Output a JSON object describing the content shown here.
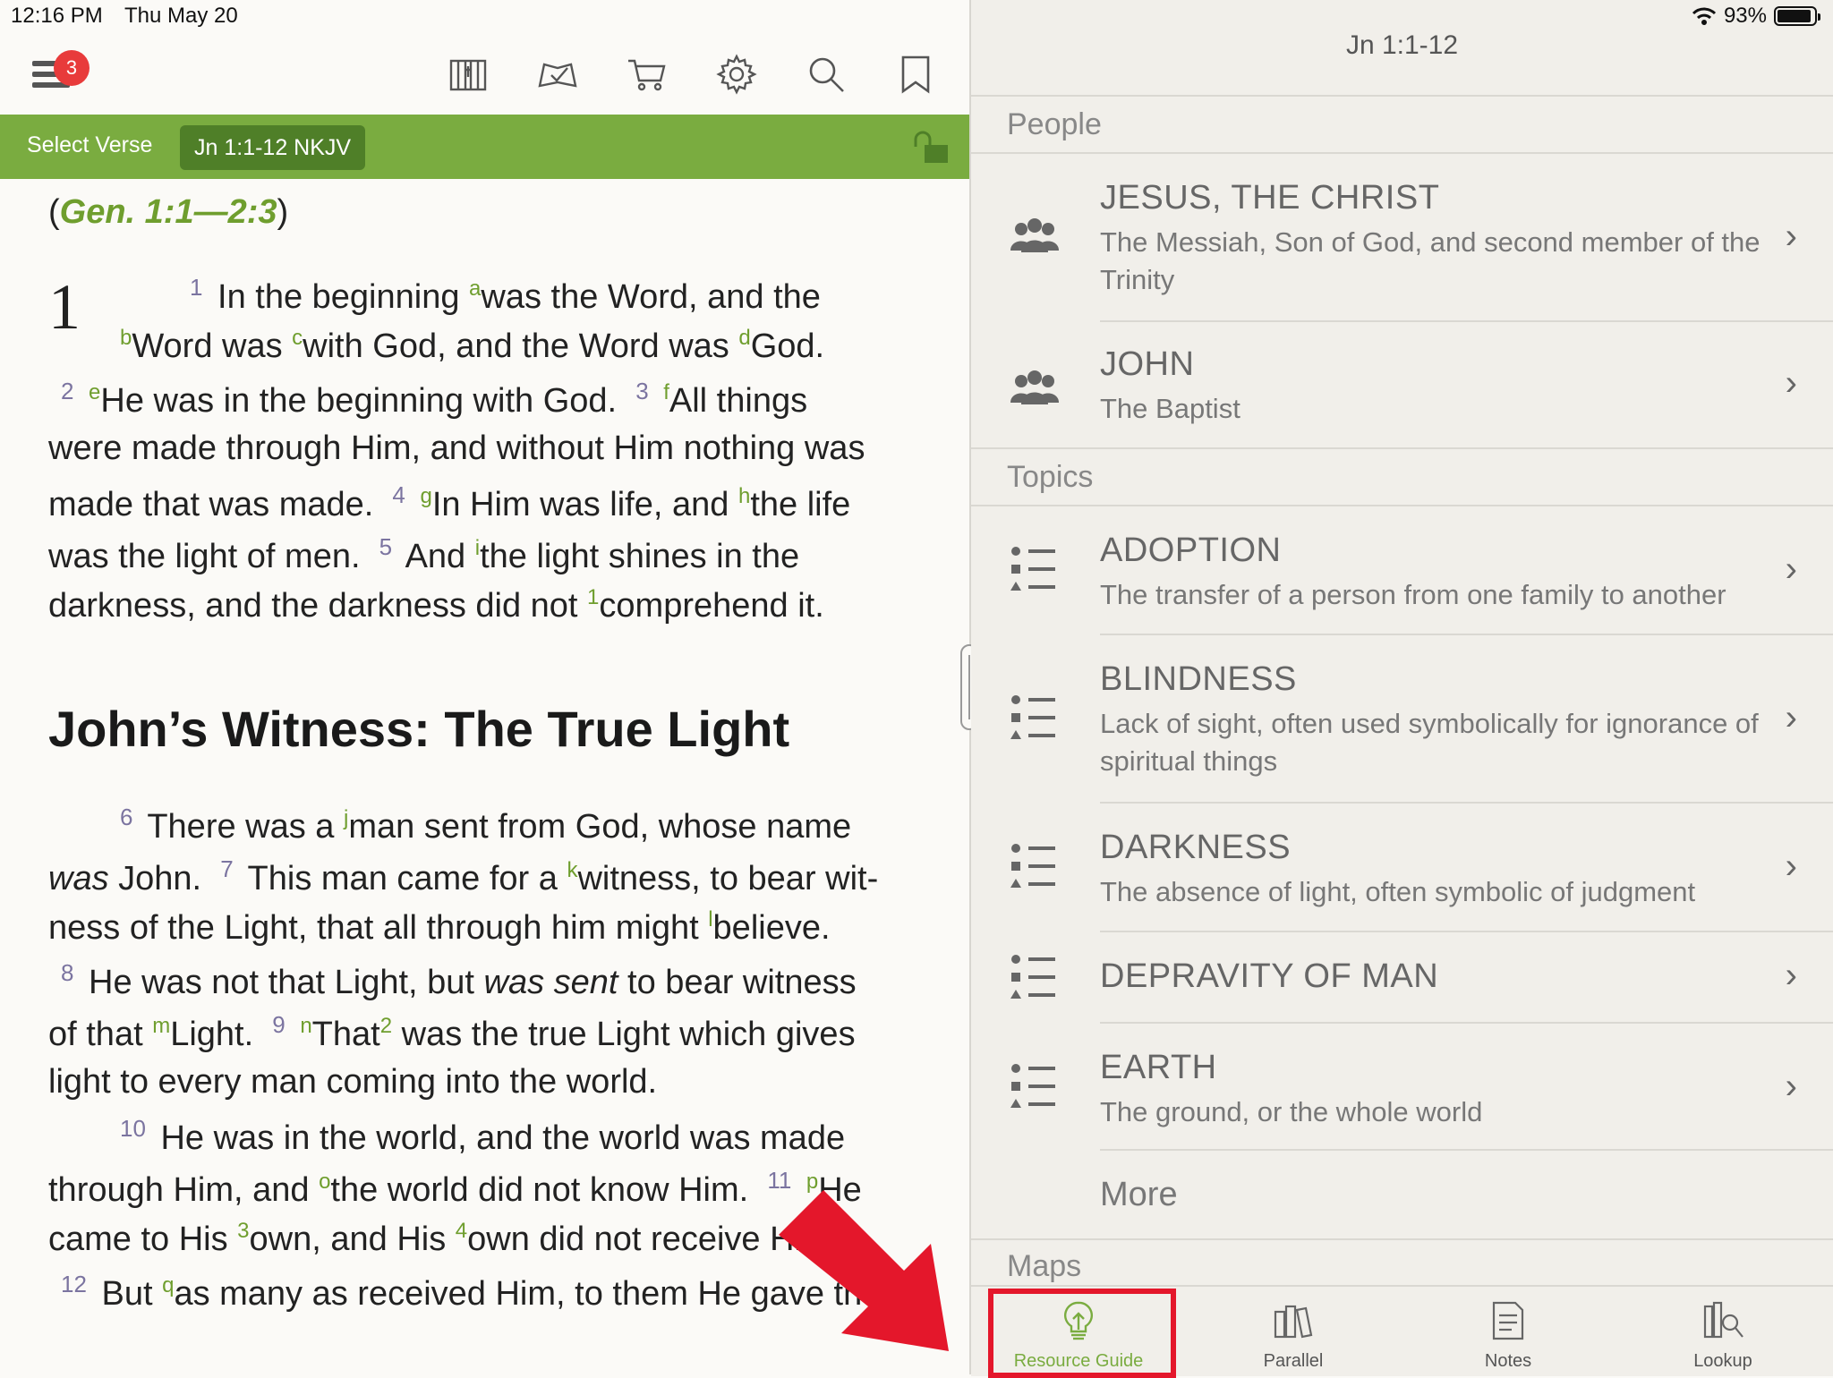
{
  "status": {
    "time": "12:16 PM",
    "date": "Thu May 20",
    "battery": "93%",
    "battery_level": 0.93
  },
  "toolbar": {
    "menu_badge": "3"
  },
  "verse_bar": {
    "select_verse": "Select Verse",
    "reference": "Jn 1:1-12 NKJV"
  },
  "text": {
    "xref_open": "(",
    "xref": "Gen. 1:1—2:3",
    "xref_close": ")",
    "chapter": "1",
    "heading": "John’s Witness: The True Light"
  },
  "panel": {
    "title": "Jn 1:1-12",
    "people_header": "People",
    "people": [
      {
        "title": "JESUS, THE CHRIST",
        "sub": "The Messiah, Son of God, and second member of the Trinity"
      },
      {
        "title": "JOHN",
        "sub": "The Baptist"
      }
    ],
    "topics_header": "Topics",
    "topics": [
      {
        "title": "ADOPTION",
        "sub": "The transfer of a person from one family to another"
      },
      {
        "title": "BLINDNESS",
        "sub": "Lack of sight, often used symbolically for ignorance of spiritual things"
      },
      {
        "title": "DARKNESS",
        "sub": "The absence of light, often symbolic of judgment"
      },
      {
        "title": "DEPRAVITY OF MAN",
        "sub": ""
      },
      {
        "title": "EARTH",
        "sub": "The ground, or the whole world"
      }
    ],
    "more": "More",
    "maps_header": "Maps"
  },
  "tabs": [
    {
      "label": "Resource Guide",
      "icon": "lightbulb-icon"
    },
    {
      "label": "Parallel",
      "icon": "books-icon"
    },
    {
      "label": "Notes",
      "icon": "notes-icon"
    },
    {
      "label": "Lookup",
      "icon": "lookup-icon"
    }
  ],
  "colors": {
    "accent_green": "#7aac40",
    "highlight_red": "#e4172b"
  }
}
